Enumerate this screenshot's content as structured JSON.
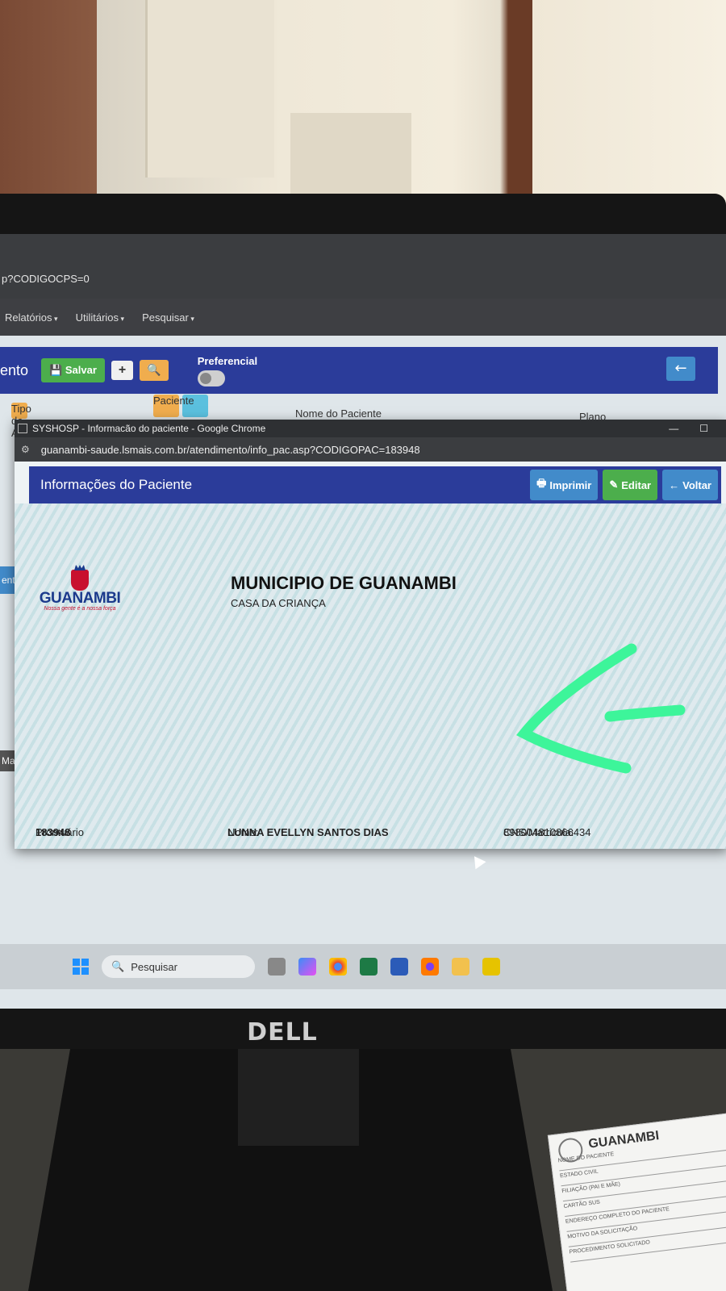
{
  "background_app": {
    "url_tail": "p?CODIGOCPS=0",
    "menus": [
      "Relatórios",
      "Utilitários",
      "Pesquisar"
    ],
    "title_fragment": "ento",
    "save_label": "Salvar",
    "add_label": "+",
    "preferencial_label": "Preferencial",
    "fields": {
      "tipo_atend": "Tipo de Atend.",
      "paciente": "Paciente",
      "nome_paciente": "Nome do Paciente",
      "plano": "Plano"
    },
    "side_fragments": [
      "ent",
      "Ma"
    ]
  },
  "popup": {
    "window_title": "SYSHOSP - Informacão do paciente - Google Chrome",
    "url": "guanambi-saude.lsmais.com.br/atendimento/info_pac.asp?CODIGOPAC=183948",
    "header_title": "Informações do Paciente",
    "actions": {
      "print": "Imprimir",
      "edit": "Editar",
      "back": "Voltar"
    },
    "logo": {
      "brand": "GUANAMBI",
      "motto": "Nossa gente é a nossa força"
    },
    "municipality": "MUNICIPIO DE GUANAMBI",
    "unit": "CASA DA CRIANÇA",
    "footer": {
      "prontuario_label": "Prontuário",
      "prontuario_value": "183948",
      "nome_label": "Nome:",
      "nome_value": "LUNNA EVELLYN SANTOS DIAS",
      "cns_label": "CNS/Matricula:",
      "cns_value": "898004810866434"
    },
    "annotation_color": "#3df59a"
  },
  "taskbar": {
    "search_placeholder": "Pesquisar",
    "apps": [
      "task-view-icon",
      "copilot-icon",
      "chrome-icon",
      "excel-icon",
      "word-icon",
      "firefox-icon",
      "file-explorer-icon",
      "sticky-notes-icon"
    ]
  },
  "monitor": {
    "brand": "DELL"
  },
  "paper": {
    "title": "GUANAMBI",
    "lines": [
      "NOME DO PACIENTE",
      "ESTADO CIVIL",
      "FILIAÇÃO (PAI E MÃE)",
      "CARTÃO SUS",
      "ENDEREÇO COMPLETO DO PACIENTE",
      "MOTIVO DA SOLICITAÇÃO",
      "PROCEDIMENTO SOLICITADO"
    ]
  }
}
